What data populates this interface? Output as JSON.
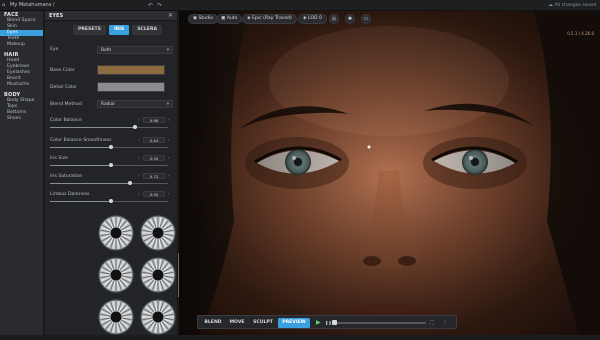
{
  "titlebar": {
    "home_icon": "⌂",
    "title": "My Metahumans /",
    "undo_icon": "↶",
    "redo_icon": "↷",
    "saved_status": "☁ All changes saved"
  },
  "sidebar": {
    "sections": [
      {
        "title": "FACE",
        "items": [
          {
            "label": "Blend Space",
            "active": false
          },
          {
            "label": "Skin",
            "active": false
          },
          {
            "label": "Eyes",
            "active": true
          },
          {
            "label": "Teeth",
            "active": false
          },
          {
            "label": "Makeup",
            "active": false
          }
        ]
      },
      {
        "title": "HAIR",
        "items": [
          {
            "label": "Head",
            "active": false
          },
          {
            "label": "Eyebrows",
            "active": false
          },
          {
            "label": "Eyelashes",
            "active": false
          },
          {
            "label": "Beard",
            "active": false
          },
          {
            "label": "Mustache",
            "active": false
          }
        ]
      },
      {
        "title": "BODY",
        "items": [
          {
            "label": "Body Shape",
            "active": false
          },
          {
            "label": "Tops",
            "active": false
          },
          {
            "label": "Bottoms",
            "active": false
          },
          {
            "label": "Shoes",
            "active": false
          }
        ]
      }
    ]
  },
  "eyes_panel": {
    "title": "EYES",
    "close_icon": "✕",
    "tabs": [
      {
        "label": "PRESETS",
        "active": false
      },
      {
        "label": "IRIS",
        "active": true
      },
      {
        "label": "SCLERA",
        "active": false
      }
    ],
    "eye": {
      "label": "Eye",
      "value": "Both",
      "chevron": "▾"
    },
    "base_color": {
      "label": "Base Color",
      "color": "#8c6a3f"
    },
    "detail_color": {
      "label": "Detail Color",
      "color": "#8a8c90"
    },
    "blend_method": {
      "label": "Blend Method",
      "value": "Radial",
      "chevron": "▾"
    },
    "sliders": [
      {
        "label": "Color Balance",
        "value": "0.98",
        "fraction": 0.72
      },
      {
        "label": "Color Balance Smoothness",
        "value": "0.44",
        "fraction": 0.52
      },
      {
        "label": "Iris Size",
        "value": "0.50",
        "fraction": 0.52
      },
      {
        "label": "Iris Saturation",
        "value": "0.72",
        "fraction": 0.68
      },
      {
        "label": "Limbus Darkness",
        "value": "0.50",
        "fraction": 0.52
      }
    ],
    "spin_left": "‹",
    "spin_right": "›",
    "iris_presets_selected_index": 5
  },
  "viewport": {
    "studio": "Studio",
    "auto": "Auto",
    "epic": "Epic (Ray Traced)",
    "lod": "LOD 0",
    "target_icon": "◎",
    "light_icon": "✺",
    "camera_icon": "▭",
    "brand": "METAHUMAN",
    "version": "0.5.1 / 4.26.0",
    "tools": [
      {
        "label": "BLEND",
        "active": false
      },
      {
        "label": "MOVE",
        "active": false
      },
      {
        "label": "SCULPT",
        "active": false
      },
      {
        "label": "PREVIEW",
        "active": true
      }
    ],
    "play_icon": "▶",
    "pause_icon": "❚❚",
    "expand_icon": "⛶",
    "menu_icon": "⋮"
  }
}
